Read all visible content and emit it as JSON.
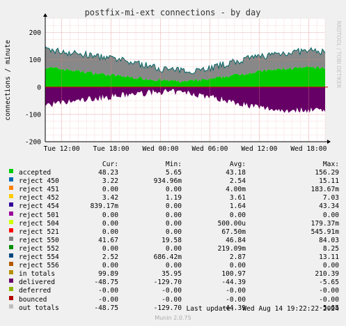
{
  "chart_data": {
    "type": "area",
    "title": "postfix-mi-ext connections - by day",
    "ylabel": "connections / minute",
    "side_label": "RRDTOOL / TOBI OETIKER",
    "ylim": [
      -200,
      250
    ],
    "y_ticks": [
      "200",
      "100",
      "0",
      "-100",
      "-200"
    ],
    "x_ticks": [
      "Tue 12:00",
      "Tue 18:00",
      "Wed 00:00",
      "Wed 06:00",
      "Wed 12:00",
      "Wed 18:00"
    ],
    "x_hours": [
      0,
      6,
      12,
      18,
      24,
      30,
      36
    ],
    "grid": true,
    "series_colors": {
      "accepted": "#00cc00",
      "reject_total": "#888888",
      "out_totals": "#660066",
      "baseline": "#cc0000",
      "reject_554": "#006666"
    },
    "profile": {
      "hours": [
        -2,
        0,
        3,
        6,
        9,
        12,
        15,
        18,
        21,
        24,
        27,
        30,
        32
      ],
      "accepted": [
        72,
        66,
        55,
        44,
        34,
        25,
        20,
        28,
        44,
        57,
        67,
        71,
        70
      ],
      "in_totals": [
        138,
        130,
        118,
        104,
        88,
        68,
        58,
        70,
        92,
        112,
        126,
        132,
        130
      ],
      "out_totals": [
        -70,
        -64,
        -50,
        -40,
        -30,
        -22,
        -25,
        -40,
        -60,
        -80,
        -90,
        -88,
        -85
      ]
    }
  },
  "legend": {
    "headers": {
      "cur": "Cur:",
      "min": "Min:",
      "avg": "Avg:",
      "max": "Max:"
    },
    "rows": [
      {
        "label": "accepted",
        "color": "#00cc00",
        "cur": "48.23",
        "min": "5.65",
        "avg": "43.18",
        "max": "156.29"
      },
      {
        "label": "reject 450",
        "color": "#0066b3",
        "cur": "3.22",
        "min": "934.96m",
        "avg": "2.54",
        "max": "15.11"
      },
      {
        "label": "reject 451",
        "color": "#ff8000",
        "cur": "0.00",
        "min": "0.00",
        "avg": "4.00m",
        "max": "183.67m"
      },
      {
        "label": "reject 452",
        "color": "#ffcc00",
        "cur": "3.42",
        "min": "1.19",
        "avg": "3.61",
        "max": "7.03"
      },
      {
        "label": "reject 454",
        "color": "#330099",
        "cur": "839.17m",
        "min": "0.00",
        "avg": "1.64",
        "max": "43.34"
      },
      {
        "label": "reject 501",
        "color": "#990099",
        "cur": "0.00",
        "min": "0.00",
        "avg": "0.00",
        "max": "0.00"
      },
      {
        "label": "reject 504",
        "color": "#ccff00",
        "cur": "0.00",
        "min": "0.00",
        "avg": "500.00u",
        "max": "179.37m"
      },
      {
        "label": "reject 521",
        "color": "#ff0000",
        "cur": "0.00",
        "min": "0.00",
        "avg": "67.50m",
        "max": "545.91m"
      },
      {
        "label": "reject 550",
        "color": "#808080",
        "cur": "41.67",
        "min": "19.58",
        "avg": "46.84",
        "max": "84.03"
      },
      {
        "label": "reject 552",
        "color": "#008f00",
        "cur": "0.00",
        "min": "0.00",
        "avg": "219.09m",
        "max": "8.25"
      },
      {
        "label": "reject 554",
        "color": "#00487d",
        "cur": "2.52",
        "min": "686.42m",
        "avg": "2.87",
        "max": "13.11"
      },
      {
        "label": "reject 556",
        "color": "#b35a00",
        "cur": "0.00",
        "min": "0.00",
        "avg": "0.00",
        "max": "0.00"
      },
      {
        "label": "in totals",
        "color": "#b38f00",
        "cur": "99.89",
        "min": "35.95",
        "avg": "100.97",
        "max": "210.39"
      },
      {
        "label": "delivered",
        "color": "#6b006b",
        "cur": "-48.75",
        "min": "-129.70",
        "avg": "-44.39",
        "max": "-5.65"
      },
      {
        "label": "deferred",
        "color": "#8fb300",
        "cur": "-0.00",
        "min": "-0.00",
        "avg": "-0.00",
        "max": "-0.00"
      },
      {
        "label": "bounced",
        "color": "#b30000",
        "cur": "-0.00",
        "min": "-0.00",
        "avg": "-0.00",
        "max": "-0.00"
      },
      {
        "label": "out totals",
        "color": "#bebebe",
        "cur": "-48.75",
        "min": "-129.70",
        "avg": "-44.39",
        "max": "-5.65"
      }
    ]
  },
  "last_update": "Last update:  Wed Aug 14 19:22:22 2024",
  "footer": "Munin 2.0.75"
}
